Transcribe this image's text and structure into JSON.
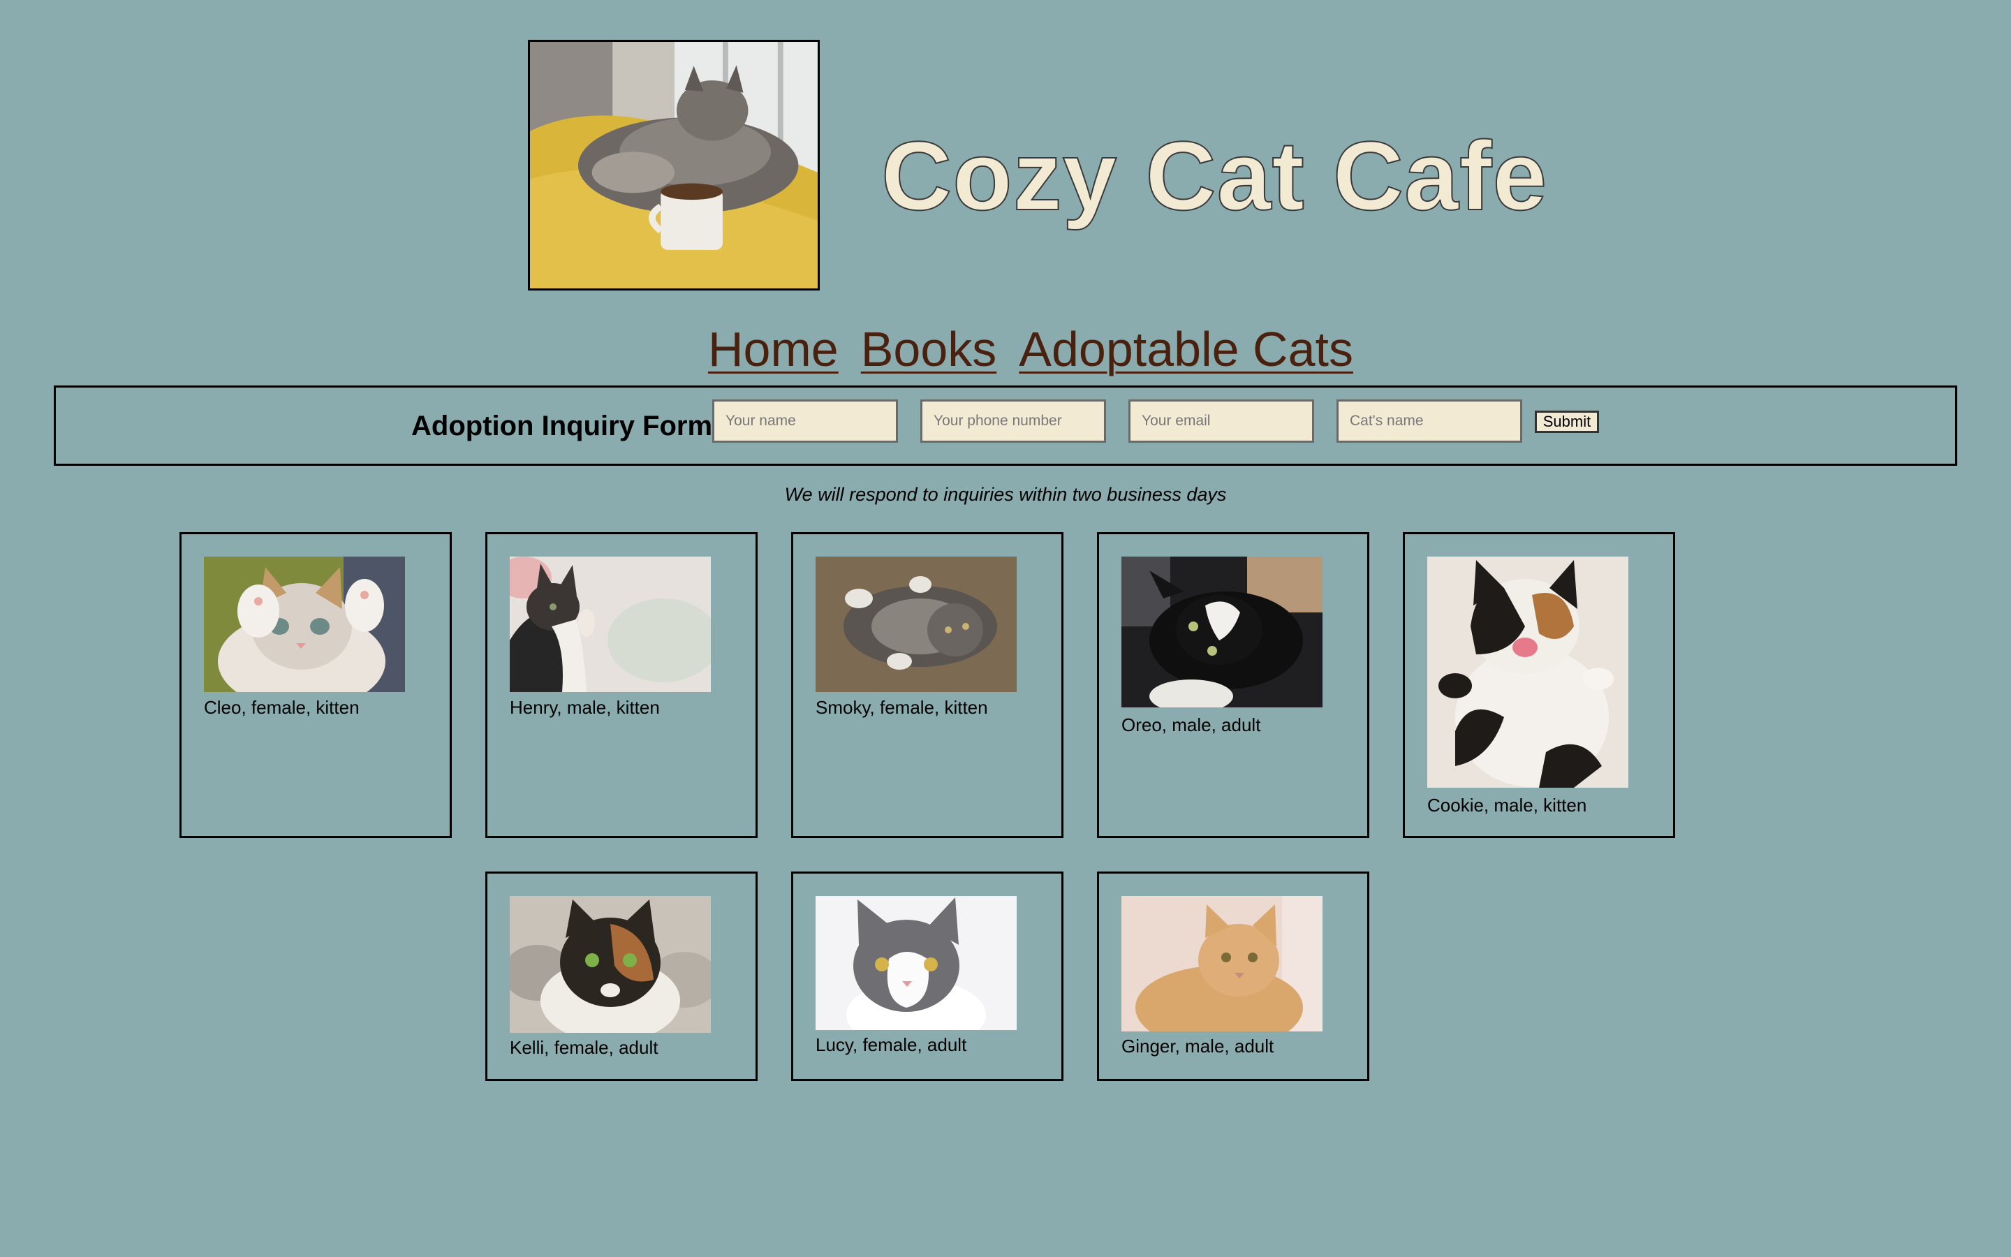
{
  "header": {
    "title": "Cozy Cat Cafe",
    "hero_image": "cat-on-yellow-blanket-with-coffee"
  },
  "nav": {
    "items": [
      {
        "label": "Home"
      },
      {
        "label": "Books"
      },
      {
        "label": "Adoptable Cats"
      }
    ]
  },
  "form": {
    "title": "Adoption Inquiry Form",
    "name_placeholder": "Your name",
    "phone_placeholder": "Your phone number",
    "email_placeholder": "Your email",
    "cat_placeholder": "Cat's name",
    "submit_label": "Submit",
    "note": "We will respond to inquiries within two business days"
  },
  "cats": [
    {
      "caption": "Cleo, female, kitten"
    },
    {
      "caption": "Henry, male, kitten"
    },
    {
      "caption": "Smoky, female, kitten"
    },
    {
      "caption": "Oreo, male, adult"
    },
    {
      "caption": "Cookie, male, kitten"
    },
    {
      "caption": "Kelli, female, adult"
    },
    {
      "caption": "Lucy, female, adult"
    },
    {
      "caption": "Ginger, male, adult"
    }
  ],
  "colors": {
    "background": "#8aacae",
    "title_fill": "#f3ead3",
    "nav_link": "#4a200f",
    "input_fill": "#f3ead3"
  }
}
